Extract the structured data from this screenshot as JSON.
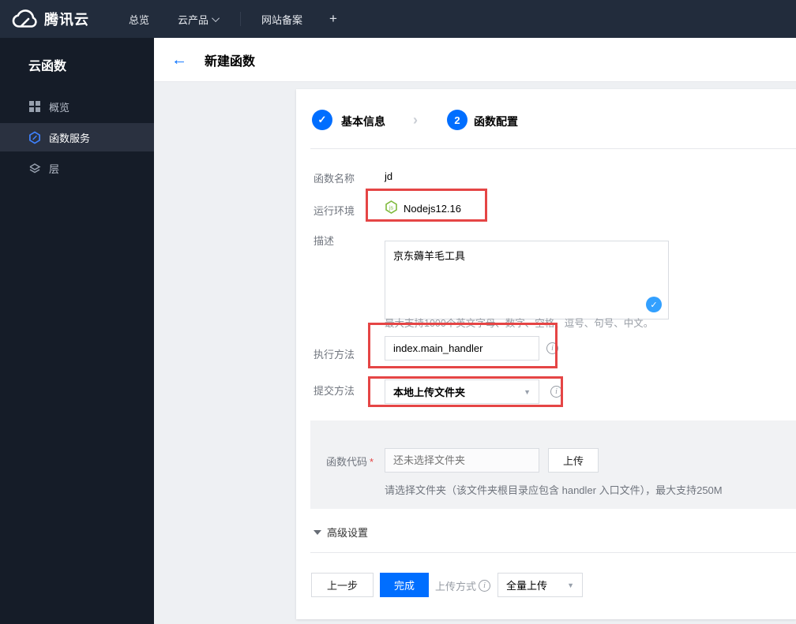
{
  "topbar": {
    "brand": "腾讯云",
    "nav_overview": "总览",
    "nav_products": "云产品",
    "nav_beian": "网站备案",
    "nav_plus": "+"
  },
  "sidebar": {
    "title": "云函数",
    "items": [
      {
        "label": "概览"
      },
      {
        "label": "函数服务"
      },
      {
        "label": "层"
      }
    ]
  },
  "header": {
    "back": "←",
    "title": "新建函数"
  },
  "steps": {
    "step1_icon": "✓",
    "step1_label": "基本信息",
    "separator": "›",
    "step2_num": "2",
    "step2_label": "函数配置"
  },
  "form": {
    "name_label": "函数名称",
    "name_value": "jd",
    "runtime_label": "运行环境",
    "runtime_icon": "js",
    "runtime_value": "Nodejs12.16",
    "desc_label": "描述",
    "desc_value": "京东薅羊毛工具",
    "desc_check": "✓",
    "desc_hint": "最大支持1000个英文字母、数字、空格、逗号、句号、中文。",
    "handler_label": "执行方法",
    "handler_value": "index.main_handler",
    "info_glyph": "i",
    "submit_label": "提交方法",
    "submit_value": "本地上传文件夹",
    "caret": "▼",
    "code_label": "函数代码",
    "code_required": "*",
    "code_placeholder": "还未选择文件夹",
    "upload_button": "上传",
    "code_hint": "请选择文件夹（该文件夹根目录应包含 handler 入口文件），最大支持250M",
    "advanced_label": "高级设置"
  },
  "footer": {
    "prev_button": "上一步",
    "done_button": "完成",
    "upload_mode_label": "上传方式",
    "upload_mode_value": "全量上传",
    "caret": "▼"
  },
  "colors": {
    "accent_blue": "#006eff",
    "check_blue": "#33a0ff",
    "annotation_red": "#e54545",
    "node_green": "#7fba3d",
    "topbar_bg": "#222c3c",
    "sidebar_bg": "#151c28"
  }
}
